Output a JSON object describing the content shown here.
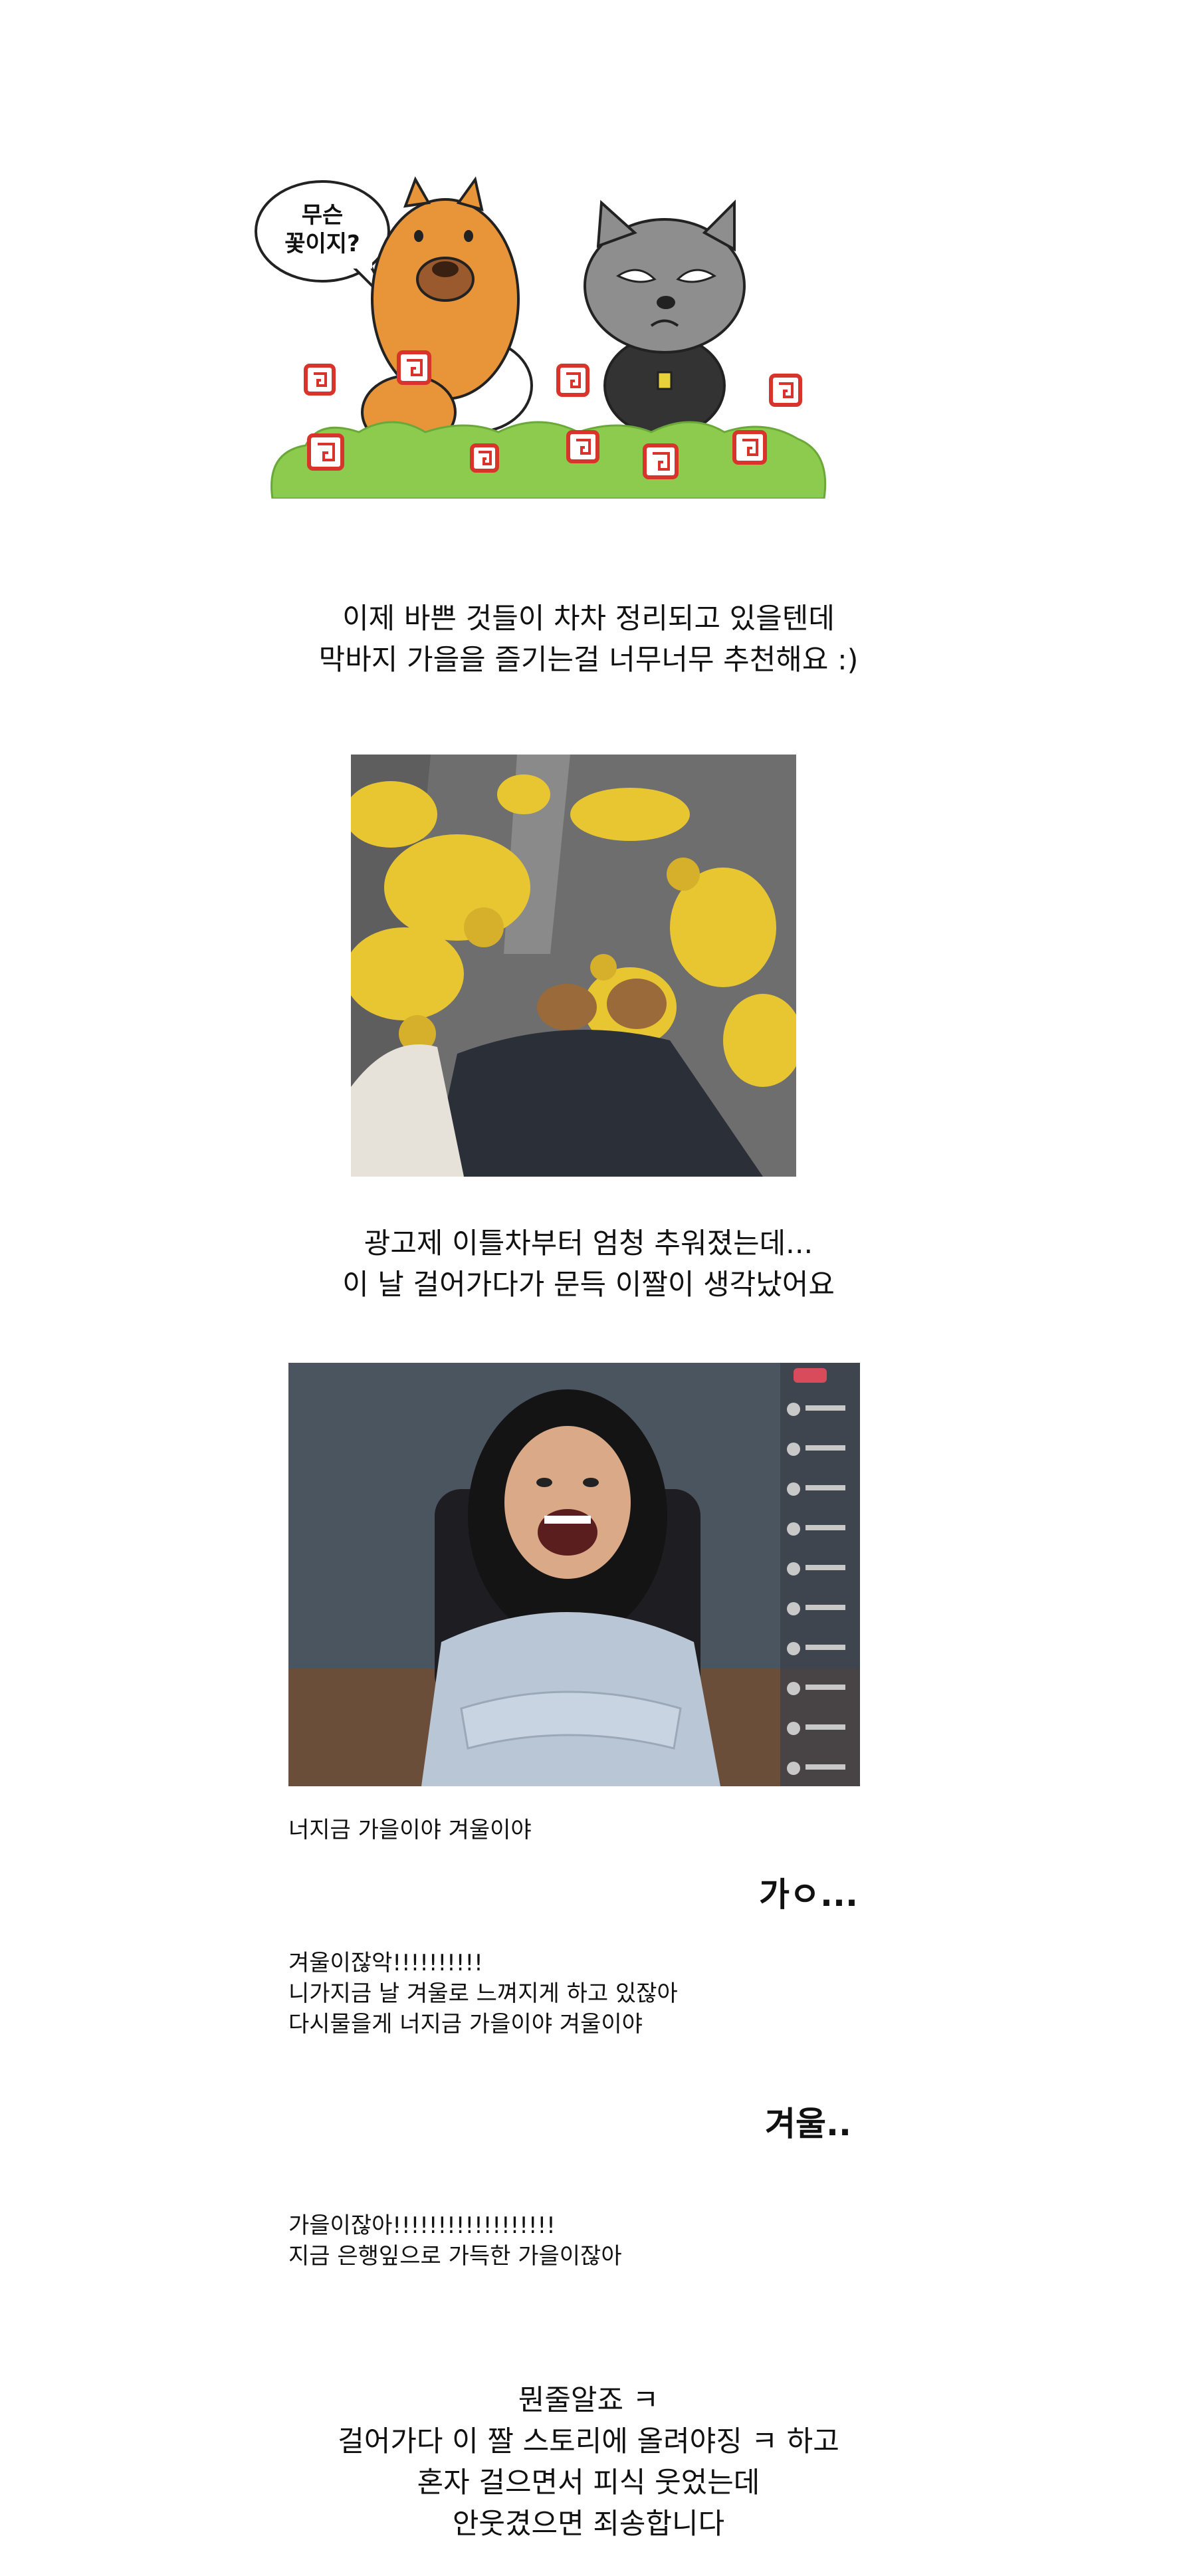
{
  "cartoon": {
    "speech_line1": "무슨",
    "speech_line2": "꽃이지?"
  },
  "text1": {
    "line1": "이제 바쁜 것들이 차차 정리되고 있을텐데",
    "line2": "막바지 가을을 즐기는걸 너무너무 추천해요 :)"
  },
  "text2": {
    "line1": "광고제 이틀차부터 엄청 추워졌는데...",
    "line2": "이 날 걸어가다가 문득 이짤이 생각났어요"
  },
  "dialog": {
    "line1": "너지금 가을이야 겨울이야",
    "reply1": "가ㅇ...",
    "block2_line1": "겨울이잖악!!!!!!!!!!",
    "block2_line2": "니가지금 날 겨울로 느껴지게 하고 있잖아",
    "block2_line3": "다시물을게 너지금 가을이야 겨울이야",
    "reply2": "겨울..",
    "block3_line1": "가을이잖아!!!!!!!!!!!!!!!!!!",
    "block3_line2": "지금 은행잎으로 가득한 가을이잖아"
  },
  "ending": {
    "line1": "뭔줄알죠 ㅋ",
    "line2": "걸어가다 이 짤 스토리에 올려야징 ㅋ 하고",
    "line3": "혼자 걸으면서 피식 웃었는데",
    "line4": "안웃겼으면 죄송합니다"
  },
  "colors": {
    "squirrel": "#E8953A",
    "cat": "#8E8E8E",
    "grass": "#8CCB4E",
    "flower": "#D9342B",
    "leaf_yellow": "#E8C632",
    "pavement": "#6E6E6E",
    "wall": "#4A5560",
    "jacket": "#B8C6D6"
  }
}
